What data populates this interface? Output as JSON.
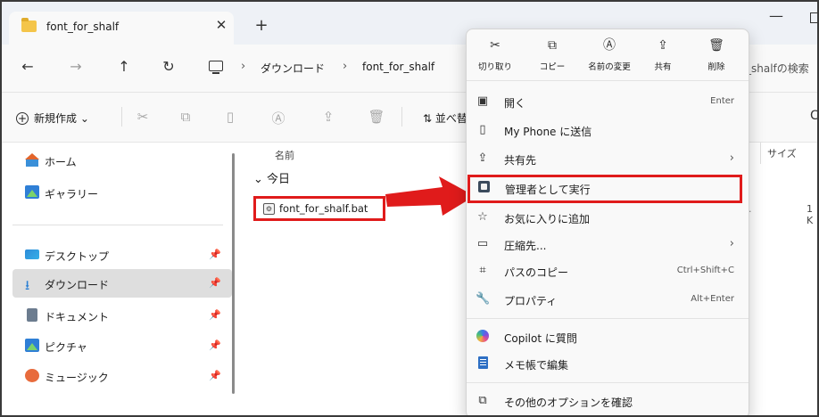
{
  "tab": {
    "title": "font_for_shalf",
    "close": "✕",
    "new": "+"
  },
  "window": {
    "minimize": "—"
  },
  "nav": {
    "back": "←",
    "forward": "→",
    "up": "↑",
    "refresh": "↻",
    "breadcrumb": [
      "ダウンロード",
      "font_for_shalf"
    ],
    "sep": "›",
    "search_placeholder": "_shalfの検索"
  },
  "command": {
    "new_label": "新規作成",
    "sort_label": "並べ替"
  },
  "sidebar": {
    "items": [
      {
        "label": "ホーム"
      },
      {
        "label": "ギャラリー"
      },
      {
        "label": "デスクトップ"
      },
      {
        "label": "ダウンロード"
      },
      {
        "label": "ドキュメント"
      },
      {
        "label": "ピクチャ"
      },
      {
        "label": "ミュージック"
      }
    ]
  },
  "files": {
    "col_name": "名前",
    "col_size": "サイズ",
    "group": "今日",
    "file_name": "font_for_shalf.bat",
    "row_dots": "...",
    "row_size": "1 K"
  },
  "context_menu": {
    "quick_actions": [
      {
        "icon": "scissors-icon",
        "label": "切り取り"
      },
      {
        "icon": "copy-icon",
        "label": "コピー"
      },
      {
        "icon": "rename-icon",
        "label": "名前の変更"
      },
      {
        "icon": "share-icon",
        "label": "共有"
      },
      {
        "icon": "delete-icon",
        "label": "削除"
      }
    ],
    "items": [
      {
        "label": "開く",
        "shortcut": "Enter"
      },
      {
        "label": "My Phone に送信"
      },
      {
        "label": "共有先"
      },
      {
        "label": "管理者として実行"
      },
      {
        "label": "お気に入りに追加"
      },
      {
        "label": "圧縮先..."
      },
      {
        "label": "パスのコピー",
        "shortcut": "Ctrl+Shift+C"
      },
      {
        "label": "プロパティ",
        "shortcut": "Alt+Enter"
      },
      {
        "label": "Copilot に質問"
      },
      {
        "label": "メモ帳で編集"
      },
      {
        "label": "その他のオプションを確認"
      }
    ]
  },
  "colors": {
    "annotation_red": "#e01b1b",
    "accent_blue": "#2a7fd4"
  }
}
